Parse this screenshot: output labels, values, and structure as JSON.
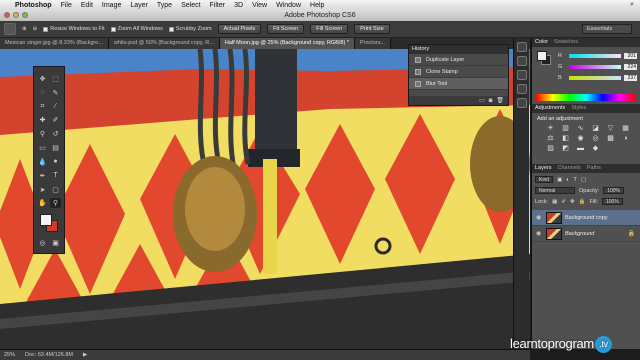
{
  "menubar": {
    "app": "Photoshop",
    "items": [
      "File",
      "Edit",
      "Image",
      "Layer",
      "Type",
      "Select",
      "Filter",
      "3D",
      "View",
      "Window",
      "Help"
    ]
  },
  "window": {
    "title": "Adobe Photoshop CS6"
  },
  "options": {
    "resize_windows": "Resize Windows to Fit",
    "zoom_all": "Zoom All Windows",
    "scrubby": "Scrubby Zoom",
    "actual_pixels": "Actual Pixels",
    "fit_screen": "Fit Screen",
    "fill_screen": "Fill Screen",
    "print_size": "Print Size",
    "workspace": "Essentials"
  },
  "tabs": [
    {
      "label": "Mexican singer.jpg @ 8.33% (Backgro...",
      "active": false
    },
    {
      "label": "white.psd @ 50% (Background copy, R...",
      "active": false
    },
    {
      "label": "Half Moon.jpg @ 25% (Background copy, RGB/8) *",
      "active": true
    },
    {
      "label": "Proctors...",
      "active": false
    }
  ],
  "history": {
    "title": "History",
    "items": [
      {
        "label": "Duplicate Layer",
        "icon": "layer-icon"
      },
      {
        "label": "Clone Stamp",
        "icon": "stamp-icon"
      },
      {
        "label": "Blur Tool",
        "icon": "blur-icon",
        "selected": true
      }
    ]
  },
  "color_panel": {
    "tabs": [
      "Color",
      "Swatches"
    ],
    "r": "201",
    "g": "224",
    "b": "237",
    "r_label": "R",
    "g_label": "G",
    "b_label": "B"
  },
  "adjustments": {
    "tabs": [
      "Adjustments",
      "Styles"
    ],
    "title": "Add an adjustment"
  },
  "layers": {
    "tabs": [
      "Layers",
      "Channels",
      "Paths"
    ],
    "kind": "Kind",
    "mode": "Normal",
    "opacity_label": "Opacity:",
    "opacity": "100%",
    "lock_label": "Lock:",
    "fill_label": "Fill:",
    "fill": "100%",
    "items": [
      {
        "name": "Background copy",
        "selected": true
      },
      {
        "name": "Background",
        "selected": false
      }
    ]
  },
  "status": {
    "zoom": "25%",
    "doc": "Doc: 63.4M/126.8M"
  },
  "watermark": {
    "text": "learntoprogram",
    "tv": ".tv"
  },
  "colors": {
    "accent": "#5c6f8c",
    "foreground": "#f0f0f0",
    "background_swatch": "#d23a2a"
  }
}
